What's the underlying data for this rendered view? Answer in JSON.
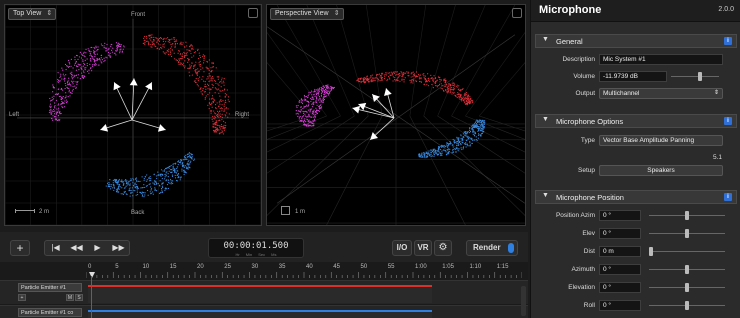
{
  "top_view": {
    "title": "Top View",
    "labels": {
      "front": "Front",
      "back": "Back",
      "left": "Left",
      "right": "Right"
    },
    "scale": "2 m"
  },
  "perspective_view": {
    "title": "Perspective View",
    "scale": "1 m"
  },
  "transport": {
    "add": "+",
    "to_start": "|◀",
    "rewind": "◀◀",
    "play": "▶",
    "forward": "▶▶",
    "timecode": "00:00:01.500",
    "timecode_units": [
      "Hr",
      "Min",
      "Sec",
      "Ms"
    ],
    "io": "I/O",
    "vr": "VR",
    "gear": "⚙",
    "render": "Render"
  },
  "timeline": {
    "ruler": [
      "0",
      "5",
      "10",
      "15",
      "20",
      "25",
      "30",
      "35",
      "40",
      "45",
      "50",
      "55",
      "1:00",
      "1:05",
      "1:10",
      "1:15"
    ],
    "tracks": [
      {
        "name": "Particle Emitter #1",
        "ctrl_m": "M",
        "ctrl_s": "S"
      },
      {
        "name": "Particle Emitter #1 co"
      }
    ]
  },
  "inspector": {
    "title": "Microphone",
    "version": "2.0.0",
    "general": {
      "title": "General",
      "description_label": "Description",
      "description_value": "Mic System #1",
      "volume_label": "Volume",
      "volume_value": "-11.9739 dB",
      "volume_level": 0.62,
      "output_label": "Output",
      "output_value": "Multichannel"
    },
    "options": {
      "title": "Microphone Options",
      "type_label": "Type",
      "type_value": "Vector Base Amplitude Panning",
      "channel_value": "5.1",
      "setup_label": "Setup",
      "setup_button": "Speakers"
    },
    "position": {
      "title": "Microphone Position",
      "rows": [
        {
          "label": "Position Azim",
          "value": "0 °",
          "level": 0.5
        },
        {
          "label": "Elev",
          "value": "0 °",
          "level": 0.5
        },
        {
          "label": "Dist",
          "value": "0 m",
          "level": 0.0
        },
        {
          "label": "Azimuth",
          "value": "0 °",
          "level": 0.5
        },
        {
          "label": "Elevation",
          "value": "0 °",
          "level": 0.5
        },
        {
          "label": "Roll",
          "value": "0 °",
          "level": 0.5
        }
      ]
    },
    "info_icon": "i"
  },
  "colors": {
    "magenta": "#d63fd6",
    "red": "#e0303a",
    "blue": "#3a8ae0",
    "accent": "#2f6fd6"
  }
}
